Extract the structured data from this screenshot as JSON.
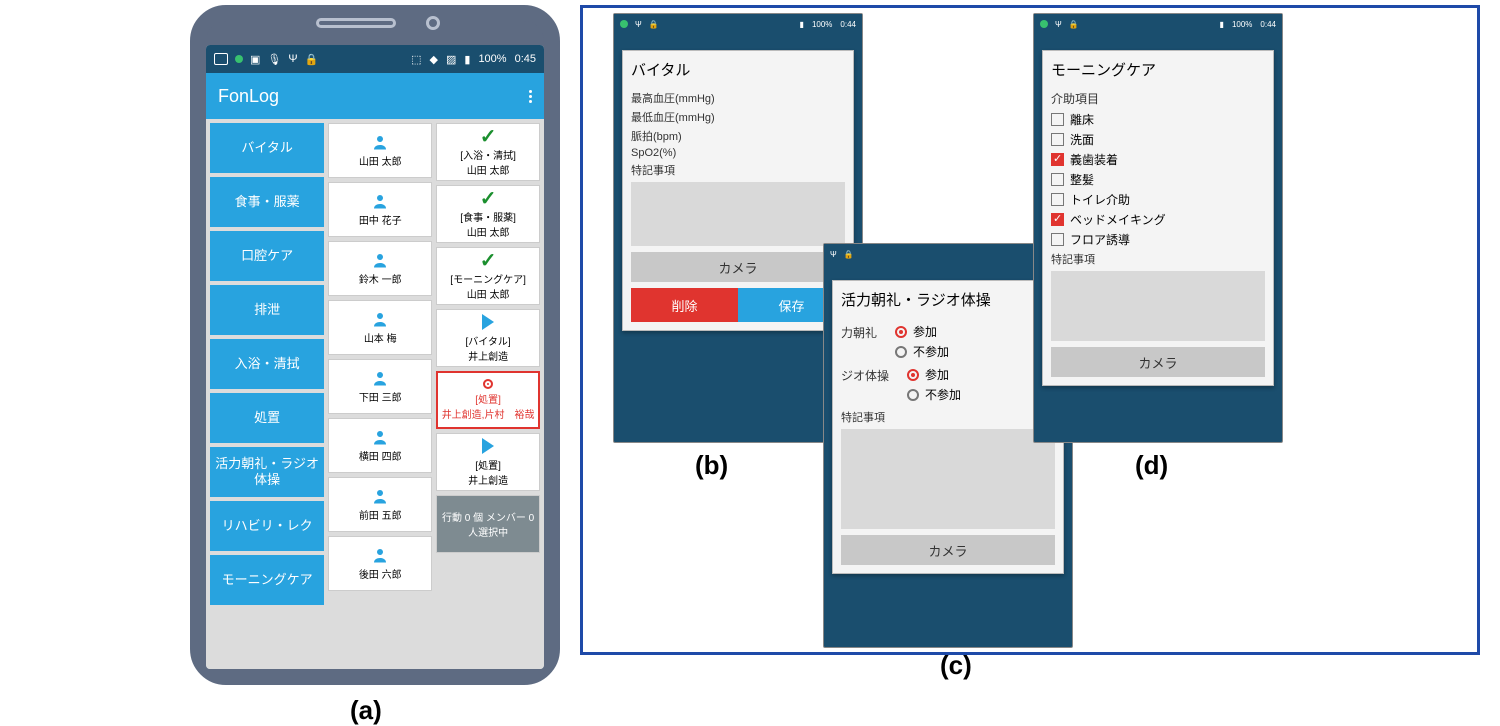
{
  "captions": {
    "a": "(a)",
    "b": "(b)",
    "c": "(c)",
    "d": "(d)"
  },
  "status": {
    "battery": "100%",
    "time_a": "0:45",
    "time_bcd": "0:44"
  },
  "app": {
    "title": "FonLog"
  },
  "categories": [
    "バイタル",
    "食事・服薬",
    "口腔ケア",
    "排泄",
    "入浴・清拭",
    "処置",
    "活力朝礼・ラジオ体操",
    "リハビリ・レク",
    "モーニングケア"
  ],
  "people": [
    "山田 太郎",
    "田中 花子",
    "鈴木 一郎",
    "山本 梅",
    "下田 三郎",
    "横田 四郎",
    "前田 五郎",
    "後田 六郎"
  ],
  "tasks": [
    {
      "kind": "tick",
      "label": "[入浴・清拭]",
      "who": "山田 太郎"
    },
    {
      "kind": "tick",
      "label": "[食事・服薬]",
      "who": "山田 太郎"
    },
    {
      "kind": "tick",
      "label": "[モーニングケア]",
      "who": "山田 太郎"
    },
    {
      "kind": "play",
      "label": "[バイタル]",
      "who": "井上創造"
    },
    {
      "kind": "rec",
      "label": "[処置]",
      "who": "井上創造,片村　裕哉"
    },
    {
      "kind": "play",
      "label": "[処置]",
      "who": "井上創造"
    },
    {
      "kind": "gray",
      "label": "行動 0 個 メンバー 0 人選択中",
      "who": ""
    }
  ],
  "vital": {
    "title": "バイタル",
    "fields": [
      "最高血圧(mmHg)",
      "最低血圧(mmHg)",
      "脈拍(bpm)",
      "SpO2(%)"
    ],
    "notes_label": "特記事項",
    "camera": "カメラ",
    "delete": "削除",
    "save": "保存"
  },
  "radio_ex": {
    "title": "活力朝礼・ラジオ体操",
    "group1_label": "力朝礼",
    "group2_label": "ジオ体操",
    "opt_join": "参加",
    "opt_nojoin": "不参加",
    "notes_label": "特記事項",
    "camera": "カメラ"
  },
  "morning": {
    "title": "モーニングケア",
    "section": "介助項目",
    "items": [
      {
        "label": "離床",
        "on": false
      },
      {
        "label": "洗面",
        "on": false
      },
      {
        "label": "義歯装着",
        "on": true
      },
      {
        "label": "整髪",
        "on": false
      },
      {
        "label": "トイレ介助",
        "on": false
      },
      {
        "label": "ベッドメイキング",
        "on": true
      },
      {
        "label": "フロア誘導",
        "on": false
      }
    ],
    "notes_label": "特記事項",
    "camera": "カメラ"
  }
}
